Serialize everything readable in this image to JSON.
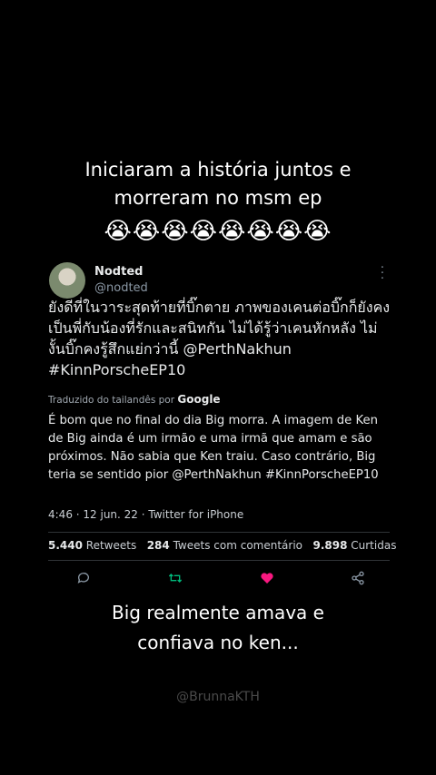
{
  "caption_top": {
    "line1": "Iniciaram a história juntos e",
    "line2": "morreram no msm ep",
    "emojis": "😭😭😭😭😭😭😭😭"
  },
  "tweet": {
    "display_name": "Nodted",
    "handle": "@nodted",
    "original_text": "ยังดีที่ในวาระสุดท้ายที่บิ๊กตาย ภาพของเคนต่อบิ๊กก็ยังคงเป็นพี่กับน้องที่รักและสนิทกัน ไม่ได้รู้ว่าเคนหักหลัง ไม่งั้นบิ๊กคงรู้สึกแย่กว่านี้ @PerthNakhun #KinnPorscheEP10",
    "translated_by_label": "Traduzido do tailandês por",
    "translated_by_brand": "Google",
    "translation_text": "É bom que no final do dia Big morra. A imagem de Ken de Big ainda é um irmão e uma irmã que amam e são próximos. Não sabia que Ken traiu. Caso contrário, Big teria se sentido pior @PerthNakhun #KinnPorscheEP10",
    "time": "4:46",
    "date": "12 jun. 22",
    "source": "Twitter for iPhone",
    "stats": {
      "retweets_count": "5.440",
      "retweets_label": "Retweets",
      "quote_count": "284",
      "quote_label": "Tweets com comentário",
      "likes_count": "9.898",
      "likes_label": "Curtidas"
    },
    "colors": {
      "retweet": "#00ba7c",
      "like": "#f91880",
      "muted": "#8b98a5"
    }
  },
  "caption_bottom": {
    "line1": "Big realmente amava e",
    "line2": "confiava no ken..."
  },
  "watermark": "@BrunnaKTH"
}
